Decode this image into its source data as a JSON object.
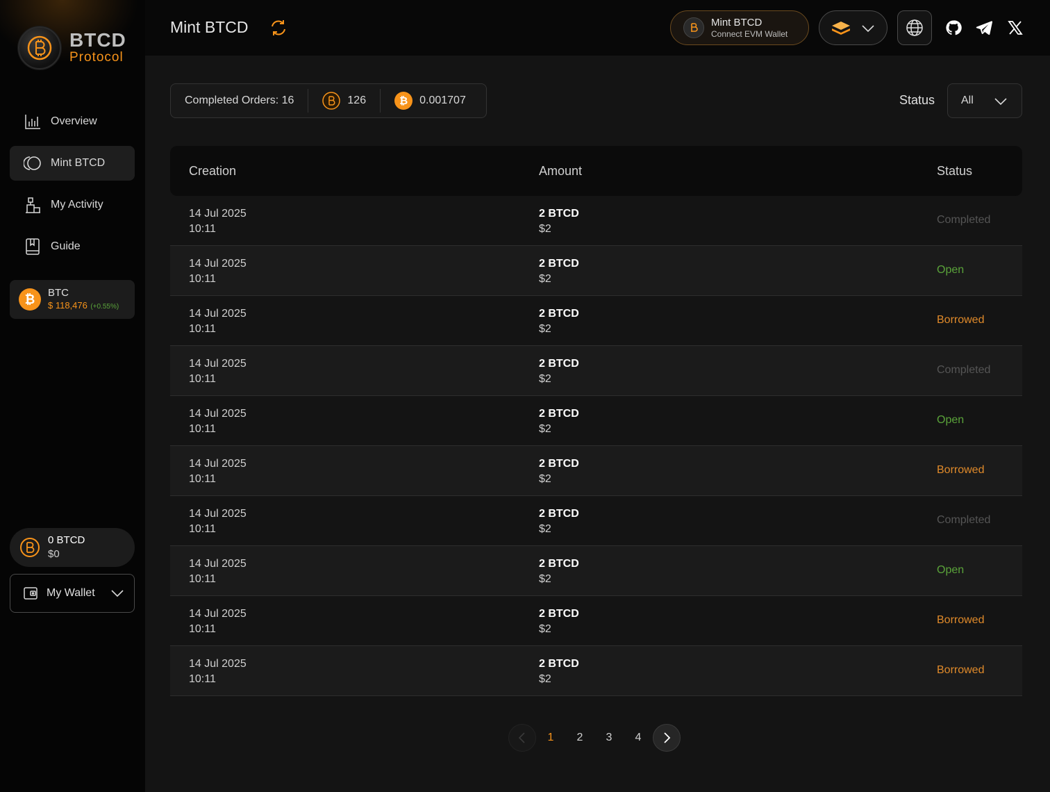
{
  "brand": {
    "title": "BTCD",
    "subtitle": "Protocol"
  },
  "colors": {
    "accent": "#f7931a",
    "open": "#5aa33a",
    "borrowed": "#e08a2a",
    "completed": "#555555"
  },
  "sidebar": {
    "items": [
      {
        "label": "Overview",
        "icon": "bar-chart-icon"
      },
      {
        "label": "Mint BTCD",
        "icon": "mint-icon"
      },
      {
        "label": "My Activity",
        "icon": "activity-icon"
      },
      {
        "label": "Guide",
        "icon": "book-icon"
      }
    ],
    "btc": {
      "name": "BTC",
      "price": "$ 118,476",
      "change": "(+0.55%)"
    },
    "balance": {
      "amount": "0 BTCD",
      "usd": "$0"
    },
    "wallet_label": "My Wallet"
  },
  "header": {
    "title": "Mint BTCD",
    "connect_title": "Mint BTCD",
    "connect_sub": "Connect EVM Wallet"
  },
  "stats": {
    "completed_orders": "Completed Orders: 16",
    "btcd_value": "126",
    "btc_value": "0.001707"
  },
  "filter": {
    "label": "Status",
    "selected": "All"
  },
  "table": {
    "columns": [
      "Creation",
      "Amount",
      "Status"
    ],
    "rows": [
      {
        "date": "14 Jul 2025",
        "time": "10:11",
        "amount": "2 BTCD",
        "usd": "$2",
        "status": "Completed"
      },
      {
        "date": "14 Jul 2025",
        "time": "10:11",
        "amount": "2 BTCD",
        "usd": "$2",
        "status": "Open"
      },
      {
        "date": "14 Jul 2025",
        "time": "10:11",
        "amount": "2 BTCD",
        "usd": "$2",
        "status": "Borrowed"
      },
      {
        "date": "14 Jul 2025",
        "time": "10:11",
        "amount": "2 BTCD",
        "usd": "$2",
        "status": "Completed"
      },
      {
        "date": "14 Jul 2025",
        "time": "10:11",
        "amount": "2 BTCD",
        "usd": "$2",
        "status": "Open"
      },
      {
        "date": "14 Jul 2025",
        "time": "10:11",
        "amount": "2 BTCD",
        "usd": "$2",
        "status": "Borrowed"
      },
      {
        "date": "14 Jul 2025",
        "time": "10:11",
        "amount": "2 BTCD",
        "usd": "$2",
        "status": "Completed"
      },
      {
        "date": "14 Jul 2025",
        "time": "10:11",
        "amount": "2 BTCD",
        "usd": "$2",
        "status": "Open"
      },
      {
        "date": "14 Jul 2025",
        "time": "10:11",
        "amount": "2 BTCD",
        "usd": "$2",
        "status": "Borrowed"
      },
      {
        "date": "14 Jul 2025",
        "time": "10:11",
        "amount": "2 BTCD",
        "usd": "$2",
        "status": "Borrowed"
      }
    ]
  },
  "pagination": {
    "pages": [
      "1",
      "2",
      "3",
      "4"
    ],
    "current": "1"
  }
}
